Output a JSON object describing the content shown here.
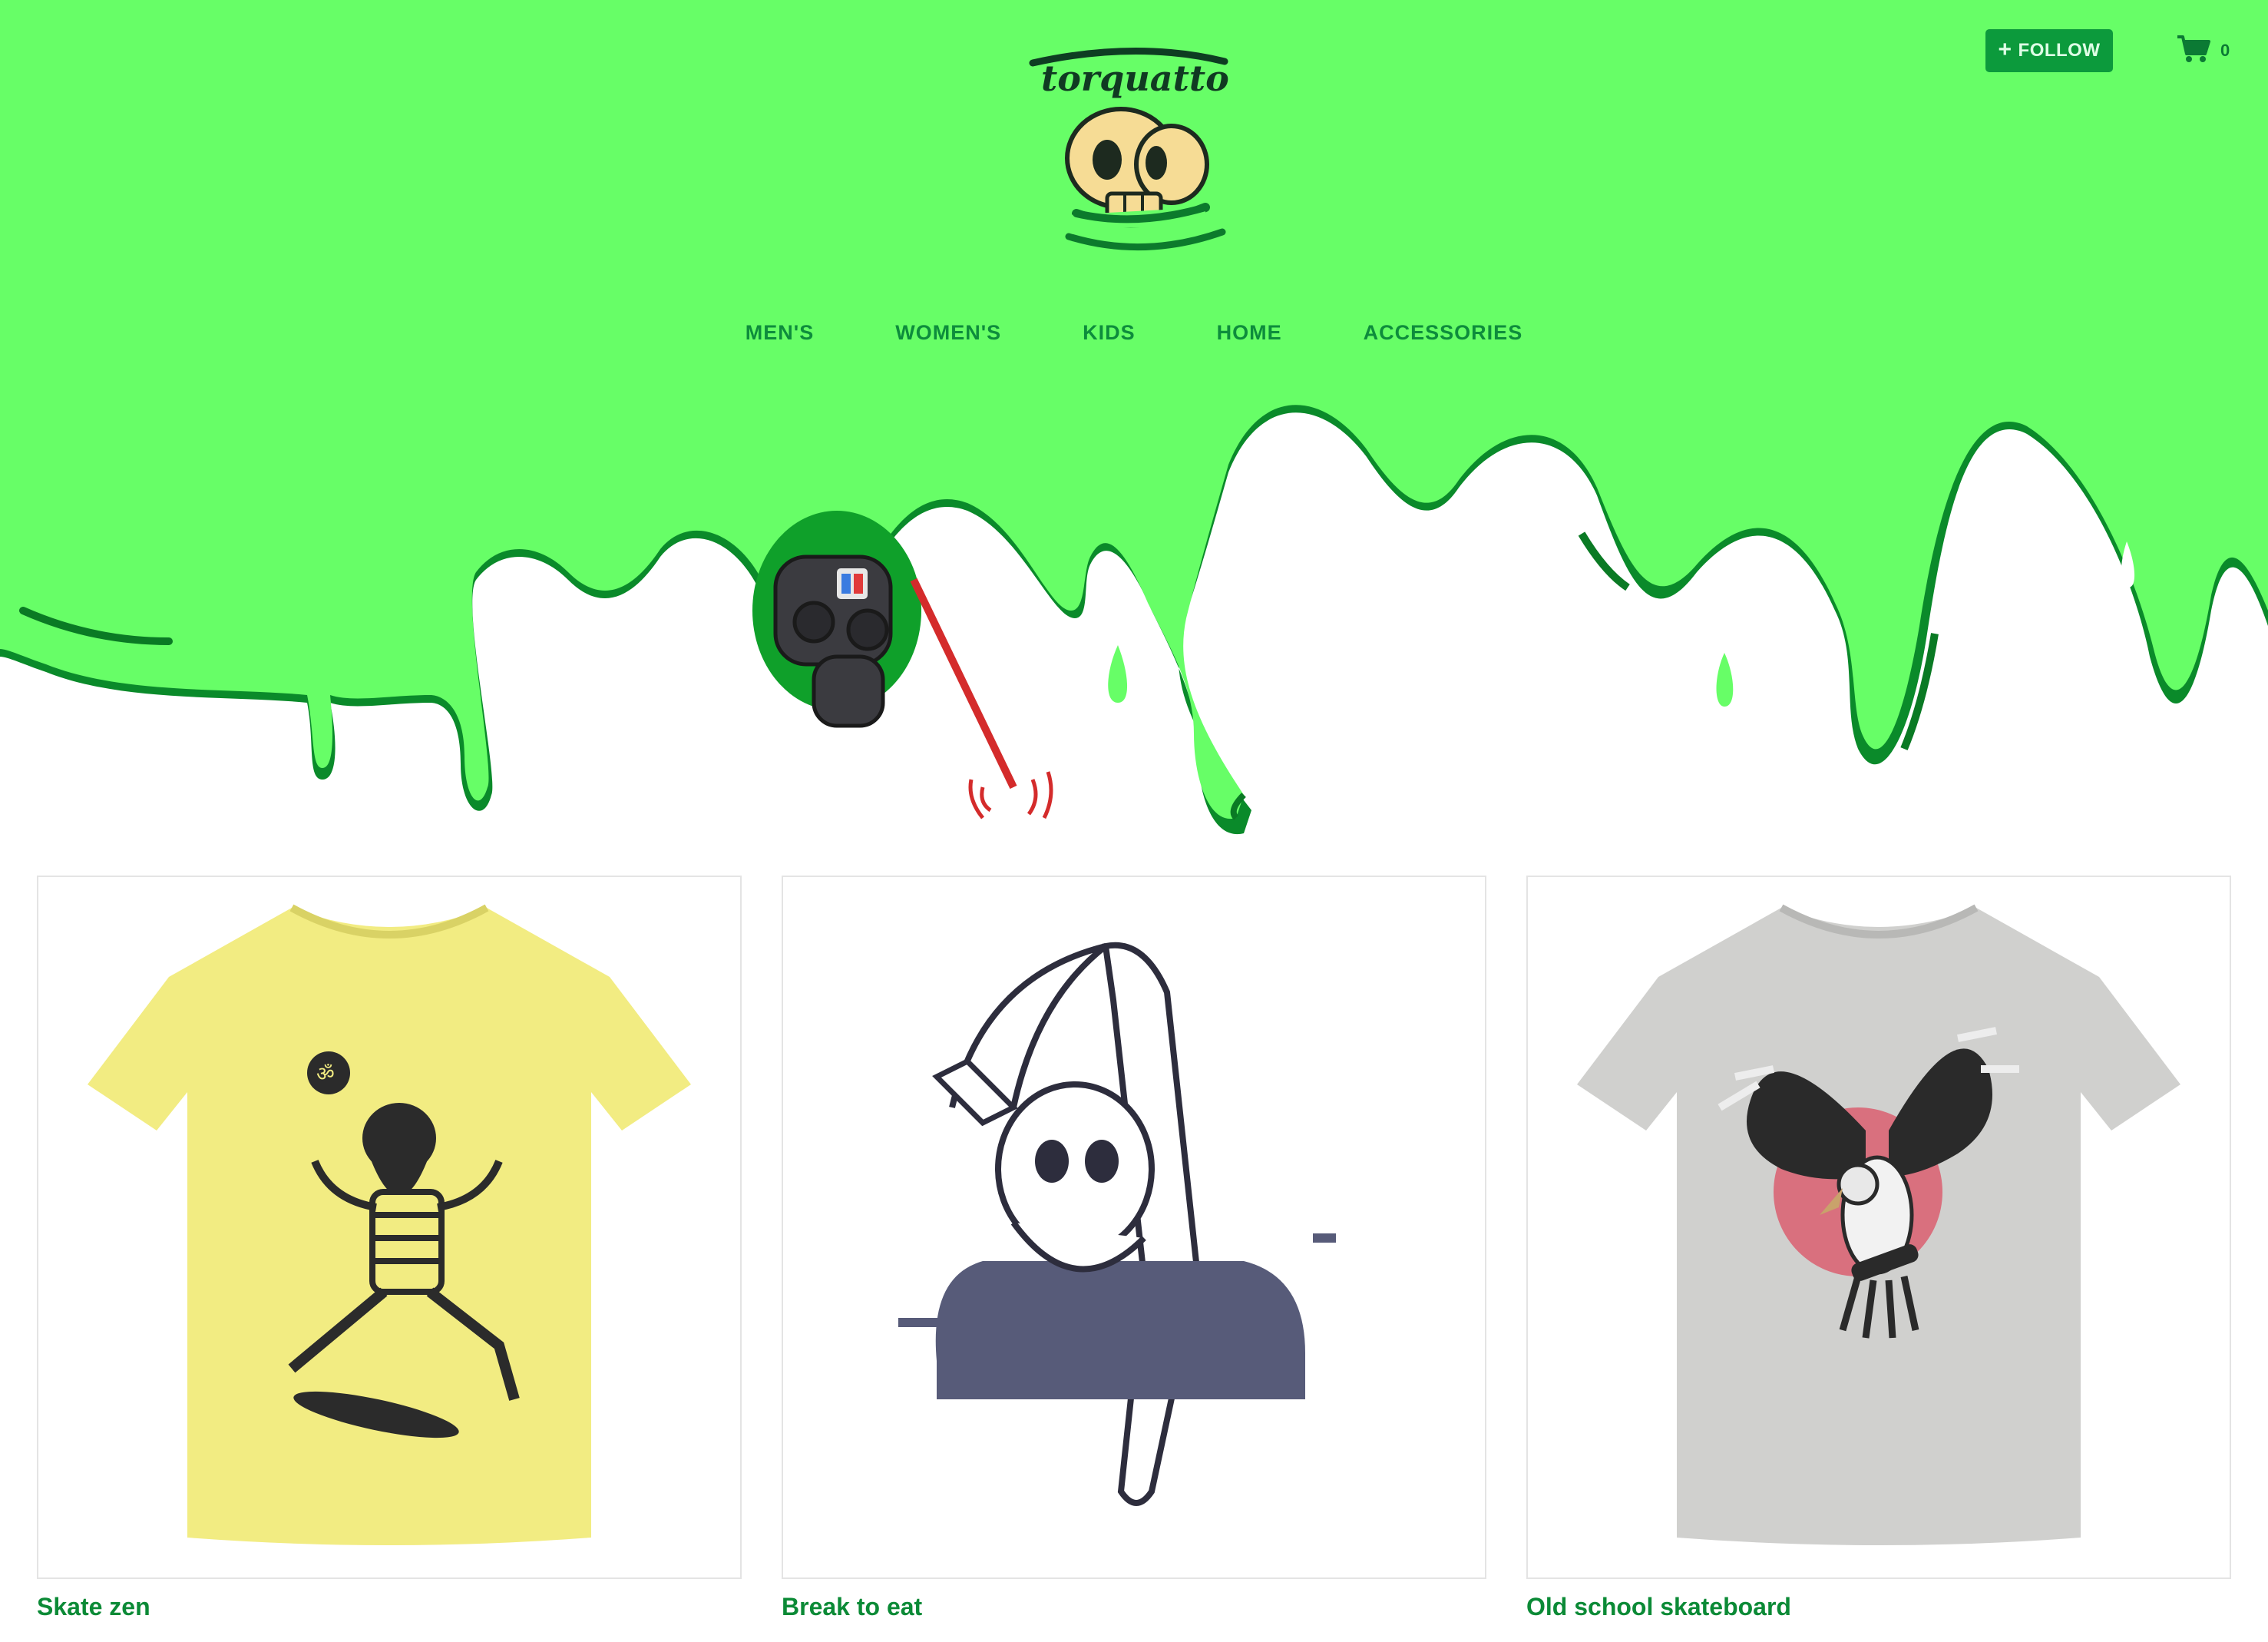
{
  "header": {
    "brand": "torquatto",
    "follow_label": "FOLLOW",
    "cart_count": "0",
    "bg_color": "#67fe67",
    "accent_color": "#0c9a3c"
  },
  "nav": {
    "items": [
      {
        "label": "MEN'S"
      },
      {
        "label": "WOMEN'S"
      },
      {
        "label": "KIDS"
      },
      {
        "label": "HOME"
      },
      {
        "label": "ACCESSORIES"
      }
    ]
  },
  "products": [
    {
      "title": "Skate zen",
      "shirt_color": "#f2ec82"
    },
    {
      "title": "Break to eat",
      "shirt_color": "#ffffff"
    },
    {
      "title": "Old school skateboard",
      "shirt_color": "#d0d0ce"
    }
  ]
}
